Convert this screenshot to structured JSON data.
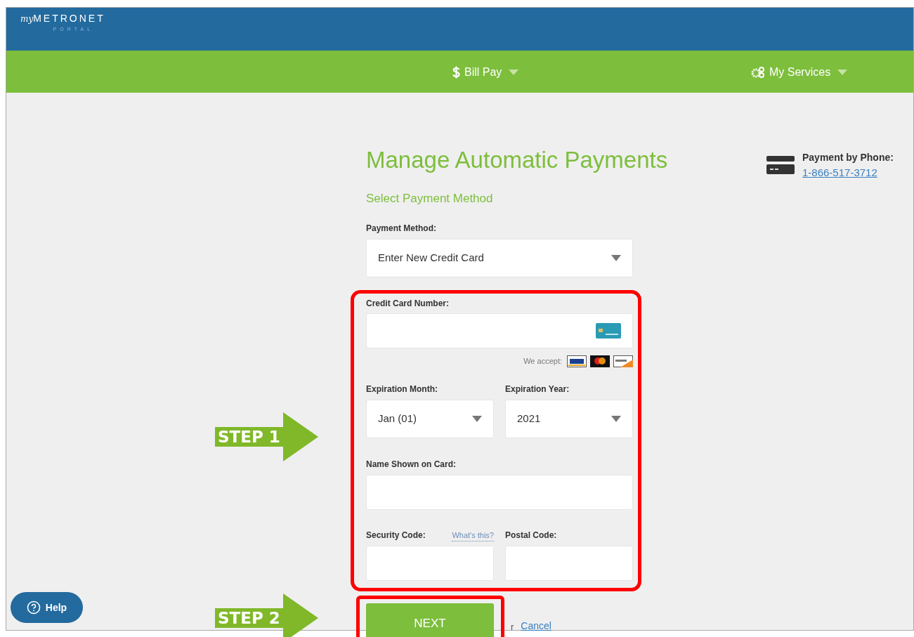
{
  "logo": {
    "script": "my",
    "name": "METRONET",
    "tagline": "PORTAL"
  },
  "nav": [
    {
      "label": "Bill Pay",
      "kind": "billing"
    },
    {
      "label": "My Services",
      "kind": "services"
    }
  ],
  "title": "Manage Automatic Payments",
  "phone": {
    "label": "Payment by Phone:",
    "number": "1-866-517-3712"
  },
  "section": "Select Payment Method",
  "payment_method": {
    "label": "Payment Method:",
    "value": "Enter New Credit Card"
  },
  "card_number": {
    "label": "Credit Card Number:"
  },
  "accept_label": "We accept:",
  "expiration_month": {
    "label": "Expiration Month:",
    "value": "Jan (01)"
  },
  "expiration_year": {
    "label": "Expiration Year:",
    "value": "2021"
  },
  "name_on_card": {
    "label": "Name Shown on Card:"
  },
  "security_code": {
    "label": "Security Code:",
    "help_link": "What's this?"
  },
  "postal_code": {
    "label": "Postal Code:"
  },
  "next_button": "NEXT",
  "or_text": "r",
  "cancel_link": "Cancel",
  "help_button": "Help",
  "annotations": [
    {
      "label": "STEP 1"
    },
    {
      "label": "STEP 2"
    }
  ]
}
